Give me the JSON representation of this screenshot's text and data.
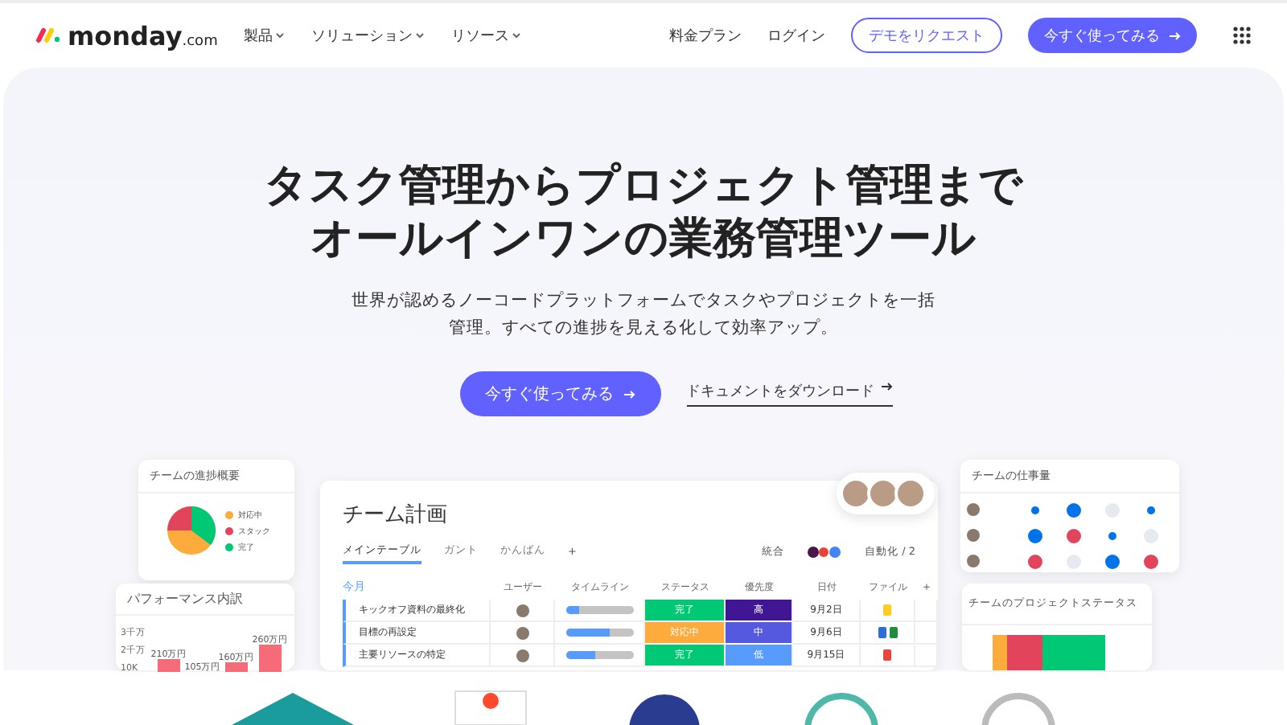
{
  "nav": {
    "logo": "monday",
    "logo_suffix": ".com",
    "menu": [
      {
        "label": "製品"
      },
      {
        "label": "ソリューション"
      },
      {
        "label": "リソース"
      }
    ],
    "links": [
      "料金プラン",
      "ログイン"
    ],
    "demo_button": "デモをリクエスト",
    "start_button": "今すぐ使ってみる"
  },
  "hero": {
    "title_lines": [
      "タスク管理からプロジェクト管理まで",
      "オールインワンの業務管理ツール"
    ],
    "subtitle_lines": [
      "世界が認めるノーコードプラットフォームでタスクやプロジェクトを一括",
      "管理。すべての進捗を見える化して効率アップ。"
    ],
    "primary_button": "今すぐ使ってみる",
    "secondary_link": "ドキュメントをダウンロード"
  },
  "progress_card": {
    "title": "チームの進捗概要",
    "legend": [
      {
        "label": "対応中",
        "color": "#fdab3d"
      },
      {
        "label": "スタック",
        "color": "#e2445c"
      },
      {
        "label": "完了",
        "color": "#00c875"
      }
    ]
  },
  "performance_card": {
    "title": "パフォーマンス内訳",
    "axis_labels": [
      "3千万",
      "2千万",
      "10K"
    ],
    "bar_labels": [
      "210万円",
      "105万円",
      "160万円",
      "260万円"
    ]
  },
  "board": {
    "title": "チーム計画",
    "tabs": [
      {
        "label": "メインテーブル",
        "selected": true
      },
      {
        "label": "ガント",
        "selected": false
      },
      {
        "label": "かんばん",
        "selected": false
      }
    ],
    "add_tab": "+",
    "integrate": "統合",
    "automate": "自動化 / 2",
    "group": "今月",
    "columns": [
      "ユーザー",
      "タイムライン",
      "ステータス",
      "優先度",
      "日付",
      "ファイル"
    ],
    "add_column": "+",
    "rows": [
      {
        "task": "キックオフ資料の最終化",
        "level": 0.2,
        "status": {
          "label": "完了",
          "color": "#00c875"
        },
        "priority": {
          "label": "高",
          "color": "#401694"
        },
        "date": "9月2日",
        "files": [
          {
            "color": "#fdcc22"
          }
        ]
      },
      {
        "task": "目標の再設定",
        "level": 0.65,
        "status": {
          "label": "対応中",
          "color": "#fdab3d"
        },
        "priority": {
          "label": "中",
          "color": "#5559df"
        },
        "date": "9月6日",
        "files": [
          {
            "color": "#2b6fd6"
          },
          {
            "color": "#1e8e3e"
          }
        ]
      },
      {
        "task": "主要リソースの特定",
        "level": 0.45,
        "status": {
          "label": "完了",
          "color": "#00c875"
        },
        "priority": {
          "label": "低",
          "color": "#579bfc"
        },
        "date": "9月15日",
        "files": [
          {
            "color": "#e8453c"
          }
        ]
      }
    ]
  },
  "workload_card": {
    "title": "チームの仕事量",
    "rows": [
      [
        {
          "kind": "small",
          "color": "#0073ea"
        },
        {
          "kind": "large",
          "color": "#0073ea"
        },
        {
          "kind": "large",
          "color": "#e6e9ef"
        },
        {
          "kind": "small",
          "color": "#0073ea"
        }
      ],
      [
        {
          "kind": "large",
          "color": "#0073ea"
        },
        {
          "kind": "large",
          "color": "#e2445c"
        },
        {
          "kind": "small",
          "color": "#0073ea"
        },
        {
          "kind": "large",
          "color": "#e6e9ef"
        }
      ],
      [
        {
          "kind": "large",
          "color": "#e2445c"
        },
        {
          "kind": "large",
          "color": "#e6e9ef"
        },
        {
          "kind": "large",
          "color": "#0073ea"
        },
        {
          "kind": "large",
          "color": "#e2445c"
        }
      ]
    ]
  },
  "project_status_card": {
    "title": "チームのプロジェクトステータス"
  }
}
